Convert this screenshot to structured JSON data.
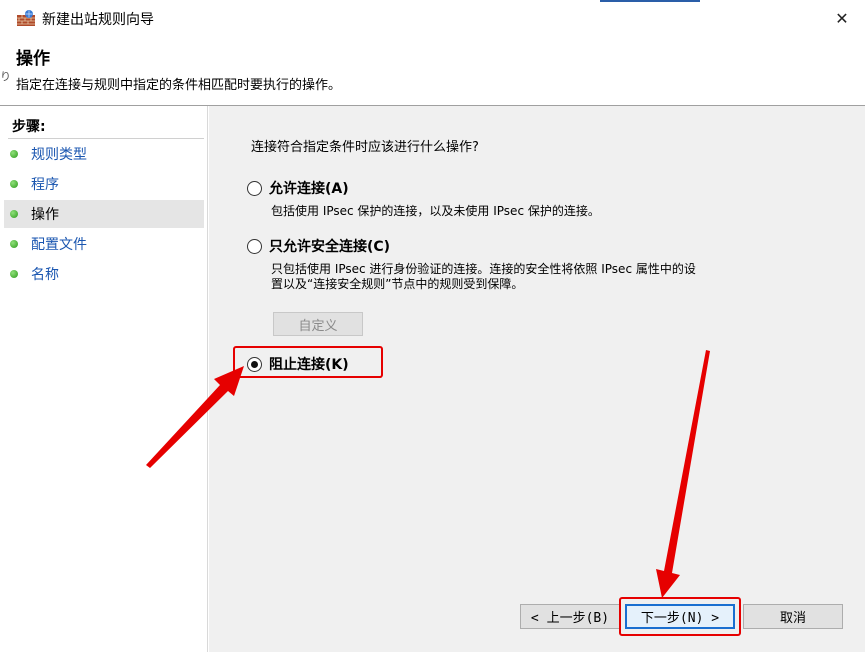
{
  "window": {
    "title": "新建出站规则向导",
    "close_glyph": "✕"
  },
  "header": {
    "title": "操作",
    "description": "指定在连接与规则中指定的条件相匹配时要执行的操作。",
    "left_mark": "り"
  },
  "sidebar": {
    "steps_label": "步骤:",
    "items": [
      {
        "label": "规则类型"
      },
      {
        "label": "程序"
      },
      {
        "label": "操作"
      },
      {
        "label": "配置文件"
      },
      {
        "label": "名称"
      }
    ]
  },
  "main": {
    "question": "连接符合指定条件时应该进行什么操作?",
    "options": [
      {
        "label": "允许连接(A)",
        "description": "包括使用 IPsec 保护的连接，以及未使用 IPsec 保护的连接。",
        "checked": false
      },
      {
        "label": "只允许安全连接(C)",
        "description_line1": "只包括使用 IPsec 进行身份验证的连接。连接的安全性将依照 IPsec 属性中的设",
        "description_line2": "置以及“连接安全规则”节点中的规则受到保障。",
        "checked": false
      },
      {
        "label": "阻止连接(K)",
        "checked": true
      }
    ],
    "custom_button": "自定义"
  },
  "buttons": {
    "back": "< 上一步(B)",
    "next": "下一步(N) >",
    "cancel": "取消"
  },
  "colors": {
    "annotation_red": "#e60000",
    "link_blue": "#1a56b0",
    "focus_blue": "#1a6fd0"
  }
}
